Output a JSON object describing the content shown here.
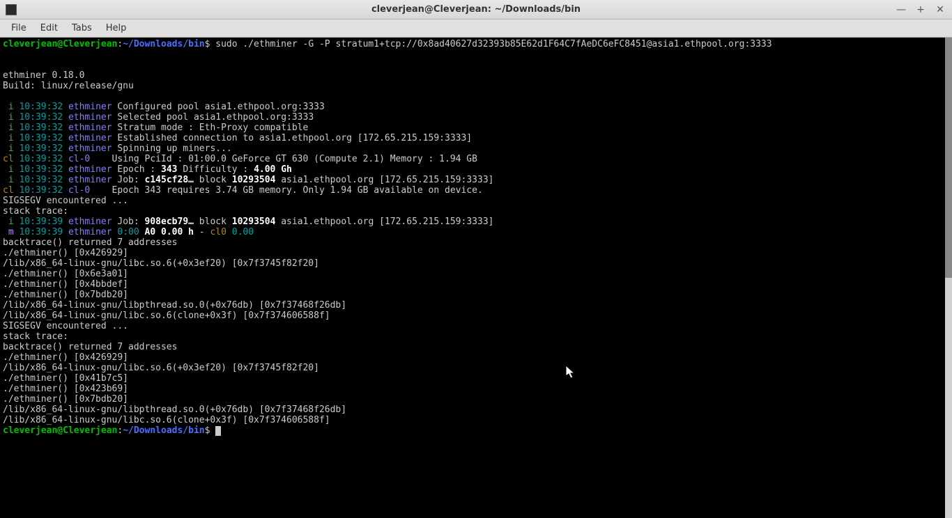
{
  "titlebar": {
    "title": "cleverjean@Cleverjean: ~/Downloads/bin"
  },
  "menubar": {
    "file": "File",
    "edit": "Edit",
    "tabs": "Tabs",
    "help": "Help"
  },
  "prompt": {
    "userhost": "cleverjean@Cleverjean",
    "colon": ":",
    "path": "~/Downloads/bin",
    "dollar": "$",
    "command": " sudo ./ethminer -G -P stratum1+tcp://0x8ad40627d32393b85E62d1F64C7fAeDC6eFC8451@asia1.ethpool.org:3333"
  },
  "header": {
    "blank1": "",
    "blank2": "",
    "version": "ethminer 0.18.0",
    "build": "Build: linux/release/gnu",
    "blank3": ""
  },
  "log": [
    {
      "prefix": " i",
      "prefix_class": "c-i-green",
      "time": " 10:39:32 ",
      "proc": "ethminer",
      "proc_class": "c-ethminer",
      "rest": " Configured pool asia1.ethpool.org:3333"
    },
    {
      "prefix": " i",
      "prefix_class": "c-i-green",
      "time": " 10:39:32 ",
      "proc": "ethminer",
      "proc_class": "c-ethminer",
      "rest": " Selected pool asia1.ethpool.org:3333"
    },
    {
      "prefix": " i",
      "prefix_class": "c-i-green",
      "time": " 10:39:32 ",
      "proc": "ethminer",
      "proc_class": "c-ethminer",
      "rest": " Stratum mode : Eth-Proxy compatible"
    },
    {
      "prefix": " i",
      "prefix_class": "c-i-green",
      "time": " 10:39:32 ",
      "proc": "ethminer",
      "proc_class": "c-ethminer",
      "rest": " Established connection to asia1.ethpool.org [172.65.215.159:3333]"
    },
    {
      "prefix": " i",
      "prefix_class": "c-i-green",
      "time": " 10:39:32 ",
      "proc": "ethminer",
      "proc_class": "c-ethminer",
      "rest": " Spinning up miners..."
    },
    {
      "prefix": "cl",
      "prefix_class": "c-cl-brown",
      "time": " 10:39:32 ",
      "proc": "cl-0   ",
      "proc_class": "c-cl0",
      "rest": " Using PciId : 01:00.0 GeForce GT 630 (Compute 2.1) Memory : 1.94 GB"
    },
    {
      "prefix": " i",
      "prefix_class": "c-i-green",
      "time": " 10:39:32 ",
      "proc": "ethminer",
      "proc_class": "c-ethminer",
      "rest_pre": " Epoch : ",
      "rest_bold": "343",
      "rest_post": " Difficulty : ",
      "rest_bold2": "4.00 Gh"
    },
    {
      "prefix": " i",
      "prefix_class": "c-i-green",
      "time": " 10:39:32 ",
      "proc": "ethminer",
      "proc_class": "c-ethminer",
      "rest_pre": " Job: ",
      "rest_bold": "c145cf28…",
      "rest_post": " block ",
      "rest_bold2": "10293504",
      "rest_post2": " asia1.ethpool.org [172.65.215.159:3333]"
    },
    {
      "prefix": "cl",
      "prefix_class": "c-cl-brown",
      "time": " 10:39:32 ",
      "proc": "cl-0   ",
      "proc_class": "c-cl0",
      "rest": " Epoch 343 requires 3.74 GB memory. Only 1.94 GB available on device."
    }
  ],
  "plain1": [
    "SIGSEGV encountered ...",
    "stack trace:"
  ],
  "log2": [
    {
      "prefix": " i",
      "prefix_class": "c-i-green",
      "time": " 10:39:39 ",
      "proc": "ethminer",
      "proc_class": "c-ethminer",
      "rest_pre": " Job: ",
      "rest_bold": "908ecb79…",
      "rest_post": " block ",
      "rest_bold2": "10293504",
      "rest_post2": " asia1.ethpool.org [172.65.215.159:3333]"
    }
  ],
  "mline": {
    "prefix": " m",
    "time": " 10:39:39 ",
    "proc": "ethminer",
    "part1": " 0:00 ",
    "part2": "A0",
    "part3": " 0.00 h",
    "part4": " - ",
    "part5": "cl0",
    "part6": " 0.00"
  },
  "plain2": [
    "backtrace() returned 7 addresses",
    "./ethminer() [0x426929]",
    "/lib/x86_64-linux-gnu/libc.so.6(+0x3ef20) [0x7f3745f82f20]",
    "./ethminer() [0x6e3a01]",
    "./ethminer() [0x4bbdef]",
    "./ethminer() [0x7bdb20]",
    "/lib/x86_64-linux-gnu/libpthread.so.0(+0x76db) [0x7f37468f26db]",
    "/lib/x86_64-linux-gnu/libc.so.6(clone+0x3f) [0x7f374606588f]",
    "SIGSEGV encountered ...",
    "stack trace:",
    "backtrace() returned 7 addresses",
    "./ethminer() [0x426929]",
    "/lib/x86_64-linux-gnu/libc.so.6(+0x3ef20) [0x7f3745f82f20]",
    "./ethminer() [0x41b7c5]",
    "./ethminer() [0x423b69]",
    "./ethminer() [0x7bdb20]",
    "/lib/x86_64-linux-gnu/libpthread.so.0(+0x76db) [0x7f37468f26db]",
    "/lib/x86_64-linux-gnu/libc.so.6(clone+0x3f) [0x7f374606588f]"
  ]
}
